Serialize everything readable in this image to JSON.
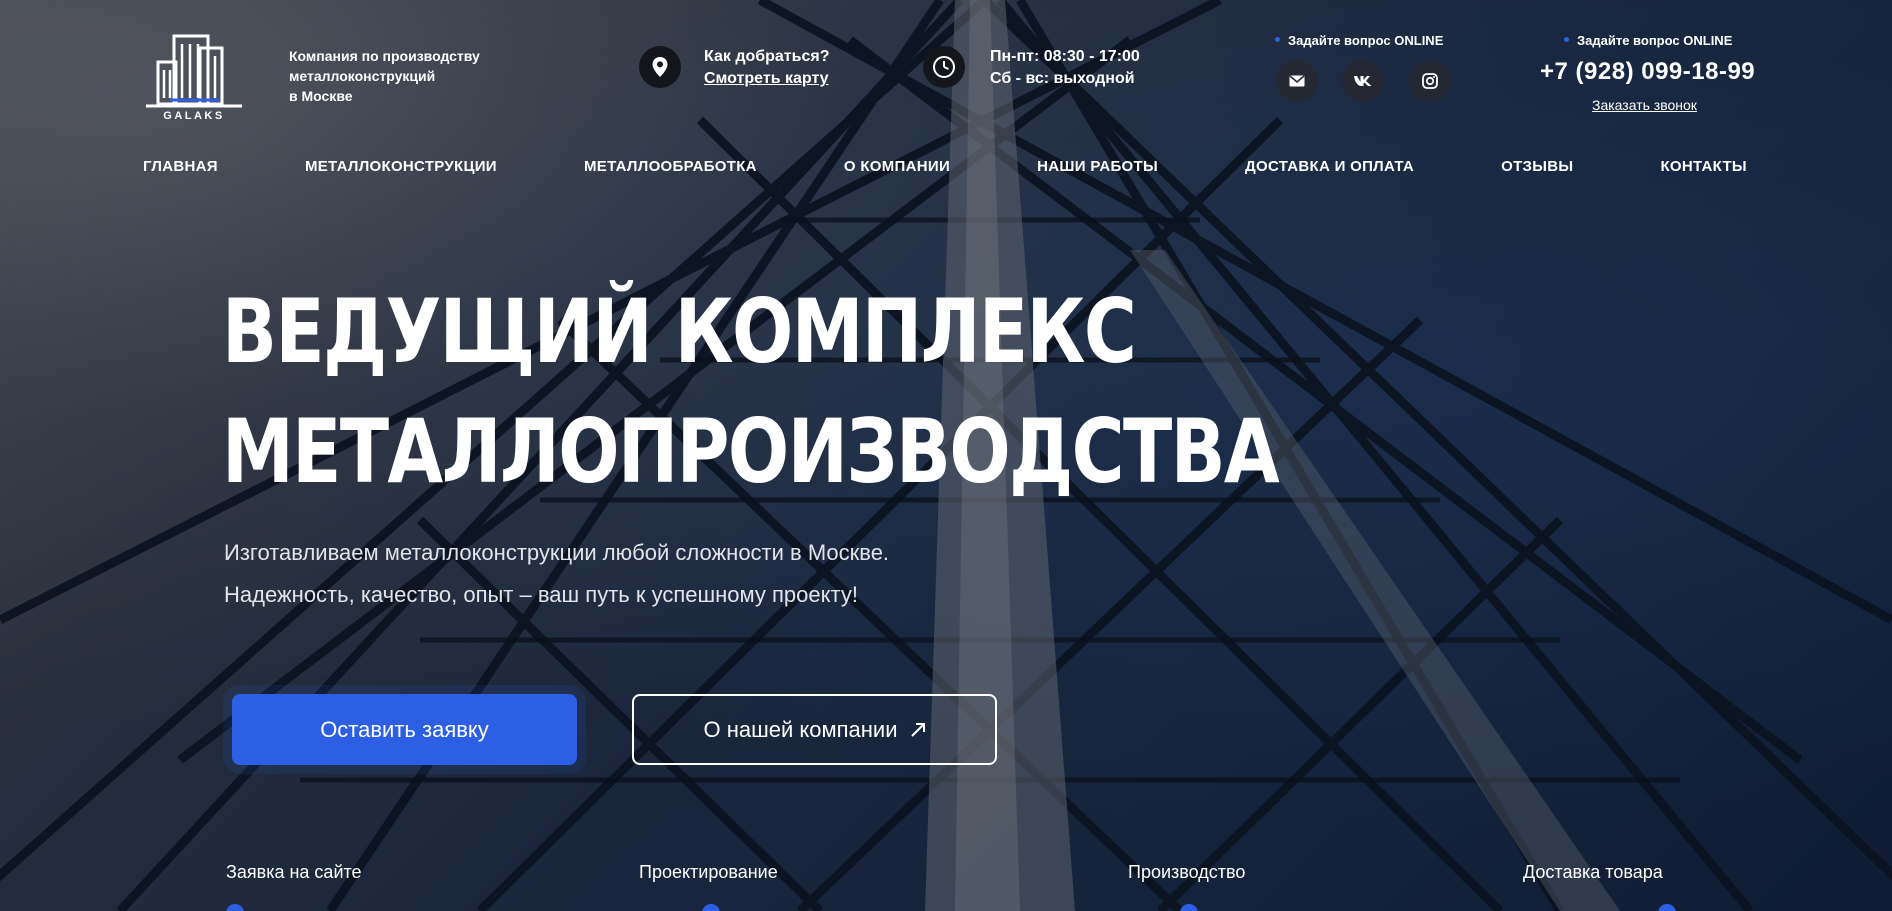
{
  "header": {
    "logo_text": "GALAKS",
    "tagline": [
      "Компания по производству",
      "металлоконструкций",
      "в Москве"
    ],
    "location": {
      "title": "Как добраться?",
      "link": "Смотреть карту"
    },
    "hours": {
      "weekdays": "Пн-пт: 08:30 - 17:00",
      "weekend": "Сб - вс: выходной"
    },
    "ask_online_1": {
      "prefix": "Задайте вопрос",
      "bold": "ONLINE"
    },
    "ask_online_2": {
      "prefix": "Задайте вопрос",
      "bold": "ONLINE"
    },
    "social_icons": [
      "mail-icon",
      "vk-icon",
      "instagram-icon"
    ],
    "phone": "+7 (928) 099-18-99",
    "callback_link": "Заказать звонок"
  },
  "nav": [
    "ГЛАВНАЯ",
    "МЕТАЛЛОКОНСТРУКЦИИ",
    "МЕТАЛЛООБРАБОТКА",
    "О КОМПАНИИ",
    "НАШИ РАБОТЫ",
    "ДОСТАВКА И ОПЛАТА",
    "ОТЗЫВЫ",
    "КОНТАКТЫ"
  ],
  "hero": {
    "title_line1": "ВЕДУЩИЙ КОМПЛЕКС",
    "title_line2": "МЕТАЛЛОПРОИЗВОДСТВА",
    "subtitle_line1": "Изготавливаем металлоконструкции любой сложности в Москве.",
    "subtitle_line2": "Надежность, качество, опыт – ваш путь к успешному проекту!",
    "primary_button": "Оставить заявку",
    "secondary_button": "О нашей компании"
  },
  "steps": [
    "Заявка на сайте",
    "Проектирование",
    "Производство",
    "Доставка товара"
  ],
  "colors": {
    "accent": "#2c5fe4",
    "dark_circle": "#14161b"
  }
}
